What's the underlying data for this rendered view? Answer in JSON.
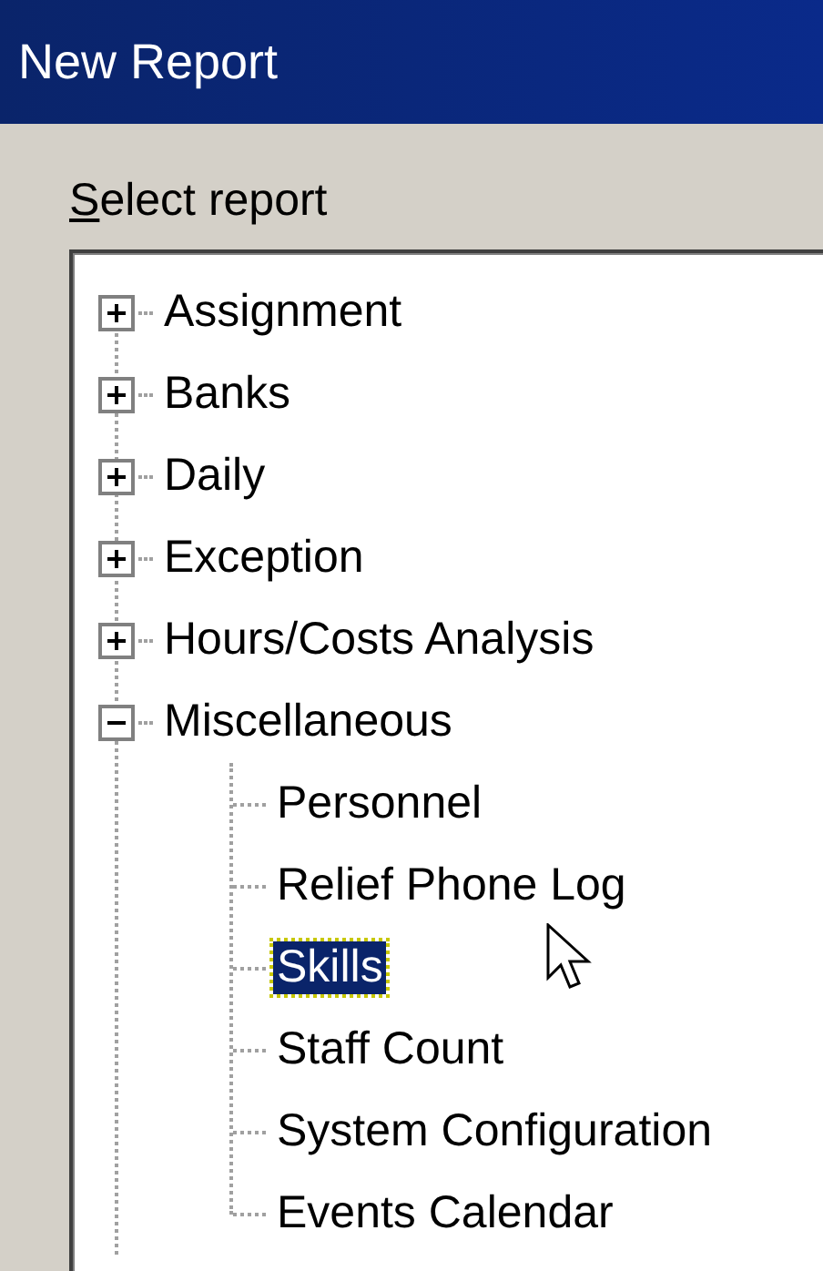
{
  "window": {
    "title": "New Report"
  },
  "select_label": {
    "text": "Select report",
    "access_key_underlined": true
  },
  "tree": [
    {
      "label": "Assignment",
      "expanded": false,
      "selected": false
    },
    {
      "label": "Banks",
      "expanded": false,
      "selected": false
    },
    {
      "label": "Daily",
      "expanded": false,
      "selected": false
    },
    {
      "label": "Exception",
      "expanded": false,
      "selected": false
    },
    {
      "label": "Hours/Costs Analysis",
      "expanded": false,
      "selected": false
    },
    {
      "label": "Miscellaneous",
      "expanded": true,
      "selected": false,
      "children": [
        {
          "label": "Personnel",
          "selected": false
        },
        {
          "label": "Relief Phone Log",
          "selected": false
        },
        {
          "label": "Skills",
          "selected": true
        },
        {
          "label": "Staff Count",
          "selected": false
        },
        {
          "label": "System Configuration",
          "selected": false
        },
        {
          "label": "Events Calendar",
          "selected": false
        }
      ]
    }
  ]
}
